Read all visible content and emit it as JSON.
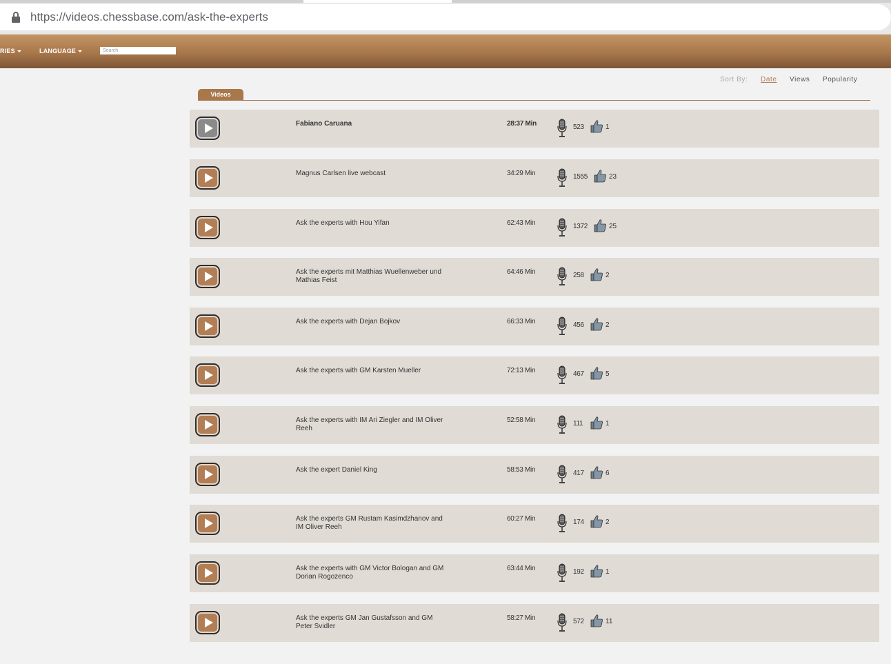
{
  "browser": {
    "url_domain": "https://videos.chessbase.com",
    "url_path": "/ask-the-experts"
  },
  "nav": {
    "items": [
      {
        "label": "RIES"
      },
      {
        "label": "LANGUAGE"
      }
    ],
    "search_placeholder": "Search"
  },
  "sort": {
    "label": "Sort By:",
    "options": [
      "Date",
      "Views",
      "Popularity"
    ],
    "active": "Date"
  },
  "tab": {
    "label": "Videos"
  },
  "videos": [
    {
      "title": "Fabiano Caruana",
      "duration": "28:37 Min",
      "views": "523",
      "likes": "1",
      "highlighted": true
    },
    {
      "title": "Magnus Carlsen live webcast",
      "duration": "34:29 Min",
      "views": "1555",
      "likes": "23"
    },
    {
      "title": "Ask the experts with Hou Yifan",
      "duration": "62:43 Min",
      "views": "1372",
      "likes": "25"
    },
    {
      "title": "Ask the experts mit Matthias Wuellenweber und Mathias Feist",
      "duration": "64:46 Min",
      "views": "258",
      "likes": "2"
    },
    {
      "title": "Ask the experts with Dejan Bojkov",
      "duration": "66:33 Min",
      "views": "456",
      "likes": "2"
    },
    {
      "title": "Ask the experts with GM Karsten Mueller",
      "duration": "72:13 Min",
      "views": "467",
      "likes": "5"
    },
    {
      "title": "Ask the experts with IM Ari Ziegler and IM Oliver Reeh",
      "duration": "52:58 Min",
      "views": "111",
      "likes": "1"
    },
    {
      "title": "Ask the expert Daniel King",
      "duration": "58:53 Min",
      "views": "417",
      "likes": "6"
    },
    {
      "title": "Ask the experts GM Rustam Kasimdzhanov and IM Oliver Reeh",
      "duration": "60:27 Min",
      "views": "174",
      "likes": "2"
    },
    {
      "title": "Ask the experts with GM Victor Bologan and GM Dorian Rogozenco",
      "duration": "63:44 Min",
      "views": "192",
      "likes": "1"
    },
    {
      "title": "Ask the experts GM Jan Gustafsson and GM Peter Svidler",
      "duration": "58:27 Min",
      "views": "572",
      "likes": "11"
    }
  ],
  "colors": {
    "nav_gradient_top": "#c29563",
    "nav_gradient_bottom": "#7d5637",
    "row_bg": "#e0dbd5",
    "play_button": "#b27e55",
    "accent_link": "#b07a58"
  }
}
